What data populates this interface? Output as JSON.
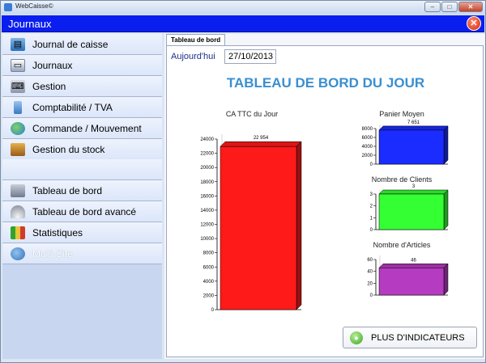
{
  "window": {
    "title": "WebCaisse©",
    "icon": "app-icon",
    "buttons": {
      "minimize": "–",
      "maximize": "□",
      "close": "✕"
    }
  },
  "header": {
    "title": "Journaux",
    "close_symbol": "✕"
  },
  "sidebar": {
    "items": [
      {
        "label": "Journal de caisse",
        "icon": "cash-journal-icon"
      },
      {
        "label": "Journaux",
        "icon": "journals-icon"
      },
      {
        "label": "Gestion",
        "icon": "management-icon"
      },
      {
        "label": "Comptabilité / TVA",
        "icon": "accounting-icon"
      },
      {
        "label": "Commande / Mouvement",
        "icon": "order-movement-icon"
      },
      {
        "label": "Gestion du stock",
        "icon": "stock-icon"
      },
      {
        "label": "Tableau de bord",
        "icon": "dashboard-icon"
      },
      {
        "label": "Tableau de bord avancé",
        "icon": "gauge-icon"
      },
      {
        "label": "Statistiques",
        "icon": "statistics-icon"
      },
      {
        "label": "Multi-Site",
        "icon": "multi-site-icon",
        "disabled": true
      }
    ]
  },
  "content": {
    "tab": "Tableau de bord",
    "date_label": "Aujourd'hui",
    "date_value": "27/10/2013",
    "board_title": "TABLEAU DE BORD DU JOUR",
    "more_button": "PLUS D'INDICATEURS",
    "more_icon": "plus-indicators-icon"
  },
  "colors": {
    "header": "#0a1ef0",
    "board_title": "#3a8fd0",
    "ca_bar": "#ff1a1a",
    "panier_bar": "#1a2cff",
    "clients_bar": "#33ff33",
    "articles_bar": "#b53bc0"
  },
  "chart_data": [
    {
      "type": "bar",
      "title": "CA TTC du Jour",
      "categories": [
        ""
      ],
      "values": [
        22954
      ],
      "data_labels": [
        "22 954"
      ],
      "ylim": [
        0,
        24000
      ],
      "yticks": [
        0,
        2000,
        4000,
        6000,
        8000,
        10000,
        12000,
        14000,
        16000,
        18000,
        20000,
        22000,
        24000
      ],
      "color": "#ff1a1a"
    },
    {
      "type": "bar",
      "title": "Panier Moyen",
      "categories": [
        ""
      ],
      "values": [
        7651
      ],
      "data_labels": [
        "7 651"
      ],
      "ylim": [
        0,
        8000
      ],
      "yticks": [
        0,
        2000,
        4000,
        6000,
        8000
      ],
      "color": "#1a2cff"
    },
    {
      "type": "bar",
      "title": "Nombre de Clients",
      "categories": [
        ""
      ],
      "values": [
        3
      ],
      "data_labels": [
        "3"
      ],
      "ylim": [
        0,
        3
      ],
      "yticks": [
        0,
        1,
        2,
        3
      ],
      "color": "#33ff33"
    },
    {
      "type": "bar",
      "title": "Nombre d'Articles",
      "categories": [
        ""
      ],
      "values": [
        46
      ],
      "data_labels": [
        "46"
      ],
      "ylim": [
        0,
        60
      ],
      "yticks": [
        0,
        20,
        40,
        60
      ],
      "color": "#b53bc0"
    }
  ]
}
